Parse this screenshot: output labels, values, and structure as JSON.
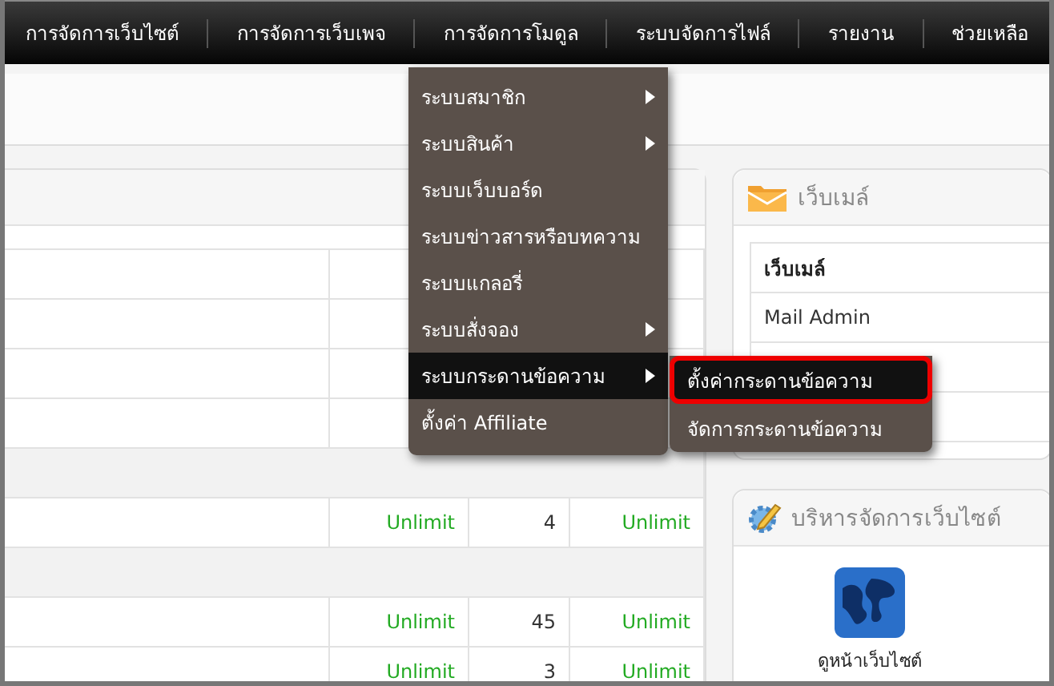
{
  "nav": [
    {
      "label": "การจัดการเว็บไซต์"
    },
    {
      "label": "การจัดการเว็บเพจ"
    },
    {
      "label": "การจัดการโมดูล"
    },
    {
      "label": "ระบบจัดการไฟล์"
    },
    {
      "label": "รายงาน"
    },
    {
      "label": "ช่วยเหลือ"
    }
  ],
  "quota_table": {
    "rows": [
      {
        "kind": "covered"
      },
      {
        "kind": "covered"
      },
      {
        "kind": "covered"
      },
      {
        "kind": "group"
      },
      {
        "kind": "data",
        "cells": [
          "Unlimit",
          "4",
          "Unlimit"
        ]
      },
      {
        "kind": "group"
      },
      {
        "kind": "data",
        "cells": [
          "Unlimit",
          "45",
          "Unlimit"
        ]
      },
      {
        "kind": "data",
        "cells": [
          "Unlimit",
          "3",
          "Unlimit"
        ]
      }
    ]
  },
  "webmail": {
    "title": "เว็บเมล์",
    "column": "เว็บเมล์",
    "rows": [
      "Mail Admin"
    ]
  },
  "site_admin": {
    "title": "บริหารจัดการเว็บไซต์",
    "link": "ดูหน้าเว็บไซต์"
  },
  "menu": [
    {
      "label": "ระบบสมาชิก",
      "submenu": true,
      "selected": false
    },
    {
      "label": "ระบบสินค้า",
      "submenu": true,
      "selected": false
    },
    {
      "label": "ระบบเว็บบอร์ด",
      "submenu": false,
      "selected": false
    },
    {
      "label": "ระบบข่าวสารหรือบทความ",
      "submenu": false,
      "selected": false
    },
    {
      "label": "ระบบแกลอรี่",
      "submenu": false,
      "selected": false
    },
    {
      "label": "ระบบสั่งจอง",
      "submenu": true,
      "selected": false
    },
    {
      "label": "ระบบกระดานข้อความ",
      "submenu": true,
      "selected": true
    },
    {
      "label": "ตั้งค่า Affiliate",
      "submenu": false,
      "selected": false
    }
  ],
  "submenu": [
    {
      "label": "ตั้งค่ากระดานข้อความ",
      "selected": true
    },
    {
      "label": "จัดการกระดานข้อความ",
      "selected": false
    }
  ]
}
